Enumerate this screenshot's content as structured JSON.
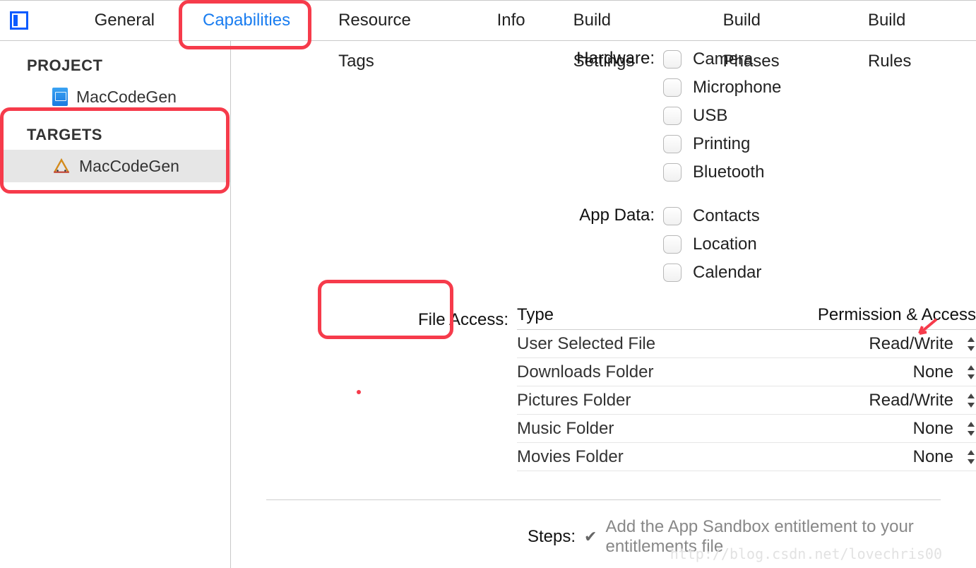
{
  "tabs": {
    "general": "General",
    "capabilities": "Capabilities",
    "resource_tags": "Resource Tags",
    "info": "Info",
    "build_settings": "Build Settings",
    "build_phases": "Build Phases",
    "build_rules": "Build Rules"
  },
  "sidebar": {
    "project_header": "PROJECT",
    "project_name": "MacCodeGen",
    "targets_header": "TARGETS",
    "target_name": "MacCodeGen"
  },
  "sections": {
    "hardware": {
      "label": "Hardware:",
      "items": [
        "Camera",
        "Microphone",
        "USB",
        "Printing",
        "Bluetooth"
      ]
    },
    "appdata": {
      "label": "App Data:",
      "items": [
        "Contacts",
        "Location",
        "Calendar"
      ]
    },
    "fileaccess": {
      "label": "File Access:",
      "col1": "Type",
      "col2": "Permission & Access",
      "rows": [
        {
          "type": "User Selected File",
          "perm": "Read/Write"
        },
        {
          "type": "Downloads Folder",
          "perm": "None"
        },
        {
          "type": "Pictures Folder",
          "perm": "Read/Write"
        },
        {
          "type": "Music Folder",
          "perm": "None"
        },
        {
          "type": "Movies Folder",
          "perm": "None"
        }
      ]
    },
    "steps": {
      "label": "Steps:",
      "text": "Add the App Sandbox entitlement to your entitlements file"
    }
  },
  "watermark": "http://blog.csdn.net/lovechris00"
}
